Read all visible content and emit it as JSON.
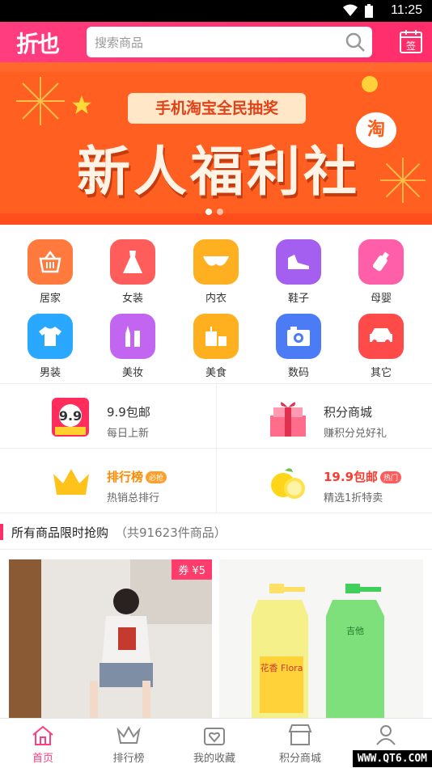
{
  "status_bar": {
    "time": "11:25"
  },
  "header": {
    "logo": "折也",
    "search_placeholder": "搜索商品",
    "signin_label": "签"
  },
  "banner": {
    "ribbon": "手机淘宝全民抽奖",
    "title": "新人福利社",
    "badge": "淘"
  },
  "categories": [
    {
      "label": "居家",
      "icon": "basket-icon",
      "color": "#ff7a3c"
    },
    {
      "label": "女装",
      "icon": "dress-icon",
      "color": "#ff5c5c"
    },
    {
      "label": "内衣",
      "icon": "bra-icon",
      "color": "#ffb020"
    },
    {
      "label": "鞋子",
      "icon": "shoe-icon",
      "color": "#a45ef0"
    },
    {
      "label": "母婴",
      "icon": "baby-bottle-icon",
      "color": "#ff5fa8"
    },
    {
      "label": "男装",
      "icon": "tshirt-icon",
      "color": "#2aa8ff"
    },
    {
      "label": "美妆",
      "icon": "makeup-icon",
      "color": "#c266f2"
    },
    {
      "label": "美食",
      "icon": "food-icon",
      "color": "#ffb01e"
    },
    {
      "label": "数码",
      "icon": "camera-icon",
      "color": "#4b7cf5"
    },
    {
      "label": "其它",
      "icon": "car-icon",
      "color": "#ff4a4a"
    }
  ],
  "promos": [
    {
      "title": "9.9包邮",
      "subtitle": "每日上新",
      "icon": "nine-nine-icon"
    },
    {
      "title": "积分商城",
      "subtitle": "赚积分兑好礼",
      "icon": "gift-icon"
    },
    {
      "title": "排行榜",
      "tag": "必抢",
      "subtitle": "热销总排行",
      "icon": "crown-icon"
    },
    {
      "title": "19.9包邮",
      "tag": "热门",
      "subtitle": "精选1折特卖",
      "icon": "lemon-icon"
    }
  ],
  "section": {
    "title": "所有商品限时抢购",
    "count": "（共91623件商品）"
  },
  "products": [
    {
      "coupon": "券 ¥5"
    },
    {
      "bottle_label": "花香 Flora",
      "bottle_label2": "吉他"
    }
  ],
  "tabbar": [
    {
      "label": "首页",
      "icon": "home-icon",
      "active": true
    },
    {
      "label": "排行榜",
      "icon": "crown-icon"
    },
    {
      "label": "我的收藏",
      "icon": "heart-icon"
    },
    {
      "label": "积分商城",
      "icon": "shop-icon"
    },
    {
      "label": "",
      "icon": "user-icon"
    }
  ],
  "watermark": "WWW.QT6.COM",
  "colors": {
    "accent": "#ff3d7f",
    "banner": "#ff5f20"
  }
}
